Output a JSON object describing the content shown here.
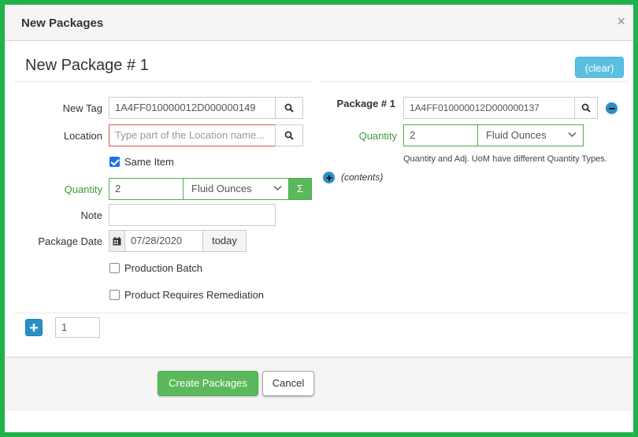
{
  "dialog": {
    "title": "New Packages",
    "close_glyph": "×",
    "close_icon": "close-icon"
  },
  "section": {
    "title": "New Package # 1",
    "clear_label": "(clear)"
  },
  "form": {
    "new_tag": {
      "label": "New Tag",
      "value": "1A4FF010000012D000000149"
    },
    "location": {
      "label": "Location",
      "placeholder": "Type part of the Location name..."
    },
    "same_item": {
      "label": "Same Item",
      "checked": true
    },
    "quantity": {
      "label": "Quantity",
      "value": "2",
      "unit": "Fluid Ounces",
      "sum_glyph": "Σ"
    },
    "note": {
      "label": "Note",
      "value": ""
    },
    "package_date": {
      "label": "Package Date",
      "value": "07/28/2020",
      "today_label": "today"
    },
    "production_batch": {
      "label": "Production Batch",
      "checked": false
    },
    "requires_remediation": {
      "label": "Product Requires Remediation",
      "checked": false
    }
  },
  "source_package": {
    "label": "Package # 1",
    "tag": "1A4FF010000012D000000137",
    "quantity_label": "Quantity",
    "quantity_value": "2",
    "unit": "Fluid Ounces",
    "warning": "Quantity and Adj. UoM have different Quantity Types.",
    "contents_label": "(contents)"
  },
  "add_row": {
    "count_value": "1"
  },
  "footer": {
    "create_label": "Create Packages",
    "cancel_label": "Cancel"
  },
  "colors": {
    "frame_border": "#22b24c",
    "accent_info": "#5bc0de",
    "success": "#5cb85c",
    "primary": "#2a8fc7",
    "label_green": "#3c9a3c",
    "error_border": "#e05050"
  }
}
